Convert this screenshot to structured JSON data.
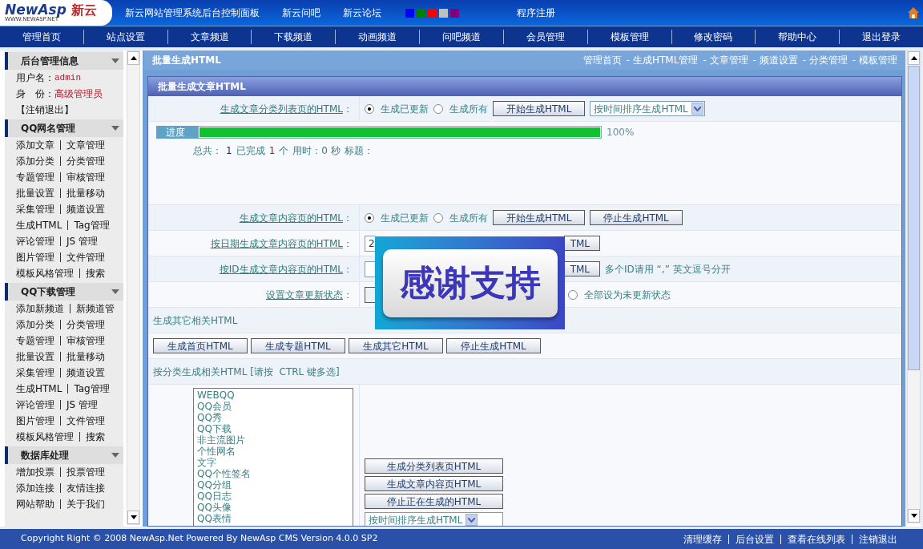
{
  "header": {
    "logo": {
      "brand": "NewAsp",
      "cn": "新云",
      "url": "WWW.NEWASP.NET"
    },
    "links": [
      "新云网站管理系统后台控制面板",
      "新云问吧",
      "新云论坛"
    ],
    "swatches": [
      {
        "color": "#0000ff"
      },
      {
        "color": "#008000"
      },
      {
        "color": "#ff0000"
      },
      {
        "color": "#c0c0c0"
      },
      {
        "color": "#800080"
      }
    ],
    "register": "程序注册"
  },
  "nav": [
    "管理首页",
    "站点设置",
    "文章频道",
    "下载频道",
    "动画频道",
    "问吧频道",
    "会员管理",
    "模板管理",
    "修改密码",
    "帮助中心",
    "退出登录"
  ],
  "sidebar": {
    "sections": [
      {
        "title": "后台管理信息",
        "kind": "info",
        "rows": [
          {
            "label": "用户名：",
            "value": "admin"
          },
          {
            "label": "身　份：",
            "value": "高级管理员"
          }
        ],
        "logout": "【注销退出】"
      },
      {
        "title": "QQ网名管理",
        "kind": "links",
        "rows": [
          [
            "添加文章",
            "文章管理"
          ],
          [
            "添加分类",
            "分类管理"
          ],
          [
            "专题管理",
            "审核管理"
          ],
          [
            "批量设置",
            "批量移动"
          ],
          [
            "采集管理",
            "频道设置"
          ],
          [
            "生成HTML",
            "Tag管理"
          ],
          [
            "评论管理",
            "JS 管理"
          ],
          [
            "图片管理",
            "文件管理"
          ],
          [
            "模板风格管理",
            "搜索"
          ]
        ]
      },
      {
        "title": "QQ下载管理",
        "kind": "links",
        "rows": [
          [
            "添加新频道",
            "新频道管"
          ],
          [
            "添加分类",
            "分类管理"
          ],
          [
            "专题管理",
            "审核管理"
          ],
          [
            "批量设置",
            "批量移动"
          ],
          [
            "采集管理",
            "频道设置"
          ],
          [
            "生成HTML",
            "Tag管理"
          ],
          [
            "评论管理",
            "JS 管理"
          ],
          [
            "图片管理",
            "文件管理"
          ],
          [
            "模板风格管理",
            "搜索"
          ]
        ]
      },
      {
        "title": "数据库处理",
        "kind": "links",
        "rows": [
          [
            "增加投票",
            "投票管理"
          ],
          [
            "添加连接",
            "友情连接"
          ],
          [
            "网站帮助",
            "关于我们"
          ]
        ]
      }
    ]
  },
  "main": {
    "title": "批量生成HTML",
    "breadcrumb": [
      "管理首页",
      "- 生成HTML管理",
      "- 文章管理",
      "- 频道设置",
      "- 分类管理",
      "- 模板管理"
    ],
    "panel_title": "批量生成文章HTML",
    "rows": [
      {
        "kind": "form",
        "label": "生成文章分类列表页的HTML：",
        "controls": [
          {
            "kind": "radio",
            "label": "生成已更新",
            "selected": true
          },
          {
            "kind": "radio",
            "label": "生成所有",
            "selected": false
          },
          {
            "kind": "button",
            "label": "开始生成HTML"
          },
          {
            "kind": "select",
            "value": "按时间排序生成HTML"
          }
        ]
      },
      {
        "kind": "progress",
        "label": "进度",
        "level": 1,
        "reading": "100%",
        "stats": [
          {
            "kind": "label",
            "text": "总共："
          },
          {
            "kind": "total",
            "text": "1"
          },
          {
            "kind": "label",
            "text": "已完成"
          },
          {
            "kind": "done",
            "text": "1"
          },
          {
            "kind": "label",
            "text": "个"
          },
          {
            "kind": "label",
            "text": "用时：0 秒"
          },
          {
            "kind": "label",
            "text": "标题："
          }
        ]
      },
      {
        "kind": "form",
        "label": "生成文章内容页的HTML：",
        "controls": [
          {
            "kind": "radio",
            "label": "生成已更新",
            "selected": true
          },
          {
            "kind": "radio",
            "label": "生成所有",
            "selected": false
          },
          {
            "kind": "button",
            "label": "开始生成HTML"
          },
          {
            "kind": "button",
            "label": "停止生成HTML"
          }
        ]
      },
      {
        "kind": "form",
        "label": "按日期生成文章内容页的HTML：",
        "controls": [
          {
            "kind": "input",
            "value": "2"
          },
          {
            "kind": "cut_button",
            "label": "TML"
          }
        ]
      },
      {
        "kind": "form",
        "label": "按ID生成文章内容页的HTML：",
        "controls": [
          {
            "kind": "input"
          },
          {
            "kind": "cut_button",
            "label": "TML"
          },
          {
            "kind": "note",
            "text": "多个ID请用 “,” 英文逗号分开"
          }
        ]
      },
      {
        "kind": "form",
        "label": "设置文章更新状态：",
        "controls": [
          {
            "kind": "box"
          },
          {
            "kind": "radio",
            "label": "全部设为未更新状态",
            "selected": false
          }
        ]
      },
      {
        "kind": "section",
        "label": "生成其它相关HTML"
      },
      {
        "kind": "buttons",
        "controls": [
          {
            "kind": "button",
            "label": "生成首页HTML"
          },
          {
            "kind": "button",
            "label": "生成专题HTML"
          },
          {
            "kind": "button",
            "label": "生成其它HTML"
          },
          {
            "kind": "button",
            "label": "停止生成HTML"
          }
        ]
      },
      {
        "kind": "section",
        "label": "按分类生成相关HTML [请按  CTRL 键多选]"
      },
      {
        "kind": "category",
        "list": [
          "WEBQQ",
          "QQ会员",
          "QQ秀",
          "QQ下载",
          "非主流图片",
          "个性网名",
          "文字",
          "QQ个性签名",
          "QQ分组",
          "QQ日志",
          "QQ头像",
          "QQ表情"
        ],
        "buttons": [
          "生成分类列表页HTML",
          "生成文章内容页HTML",
          "停止正在生成的HTML"
        ],
        "select": "按时间排序生成HTML"
      }
    ]
  },
  "overlay": {
    "text": "感谢支持"
  },
  "footer": {
    "copyright": "Copyright Right © 2008 NewAsp.Net Powered By NewAsp CMS Version 4.0.0 SP2",
    "links": [
      "清理缓存",
      "后台设置",
      "查看在线列表",
      "注销退出"
    ]
  }
}
